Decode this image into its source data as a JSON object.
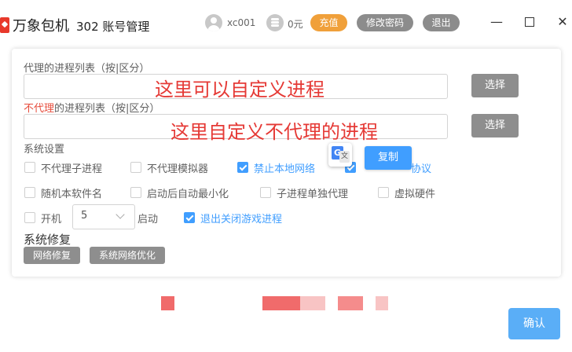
{
  "header": {
    "app_name": "万象包机",
    "subtitle": "302 账号管理",
    "username": "xc001",
    "balance": "0元",
    "recharge_label": "充值",
    "change_password_label": "修改密码",
    "logout_label": "退出",
    "minimize_glyph": "—",
    "close_glyph": "✕"
  },
  "proxy_section": {
    "label": "代理的进程列表（按|区分）",
    "overlay_hint": "这里可以自定义进程",
    "select_label": "选择"
  },
  "noproxy_section": {
    "label_red": "不代理",
    "label_rest": "的进程列表（按|区分）",
    "overlay_hint": "这里自定义不代理的进程",
    "select_label": "选择"
  },
  "settings": {
    "title": "系统设置",
    "options": [
      {
        "label": "不代理子进程",
        "checked": false
      },
      {
        "label": "不代理模拟器",
        "checked": false
      },
      {
        "label": "禁止本地网络",
        "checked": true
      },
      {
        "label": "协议",
        "checked": true
      },
      {
        "label": "随机本软件名",
        "checked": false
      },
      {
        "label": "启动后自动最小化",
        "checked": false
      },
      {
        "label": "子进程单独代理",
        "checked": false
      },
      {
        "label": "虚拟硬件",
        "checked": false
      }
    ],
    "boot_label": "开机",
    "boot_delay_value": "5",
    "start_label": "启动",
    "exit_game_label": "退出关闭游戏进程",
    "exit_game_checked": true
  },
  "repair": {
    "title": "系统修复",
    "network_repair_label": "网络修复",
    "network_optimize_label": "系统网络优化"
  },
  "popup": {
    "translate_icon": "google-translate-icon",
    "copy_label": "复制"
  },
  "confirm_label": "确认",
  "colors": {
    "accent": "#409eff",
    "recharge": "#f0a03a",
    "hint_red": "#e53935",
    "gray_button": "#8e8e8e"
  }
}
